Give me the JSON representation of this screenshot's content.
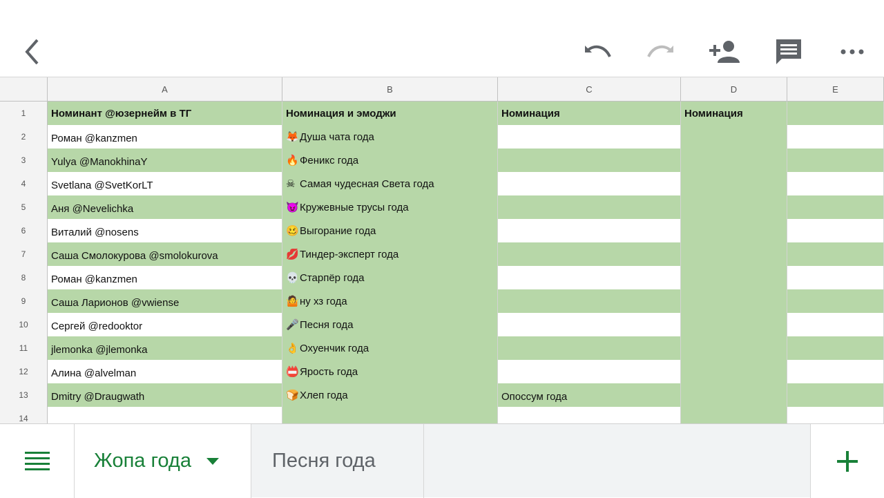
{
  "toolbar": {
    "back_icon": "chevron-left-icon",
    "undo_icon": "undo-icon",
    "redo_icon": "redo-icon",
    "share_icon": "add-person-icon",
    "comment_icon": "comment-icon",
    "more_icon": "more-horizontal-icon"
  },
  "columns": [
    "A",
    "B",
    "C",
    "D",
    "E"
  ],
  "rows": [
    {
      "num": "1",
      "a": "Номинант @юзернейм в ТГ",
      "b_emoji": "",
      "b": "Номинация и эмоджи",
      "c": "Номинация",
      "d": "Номинация",
      "e": ""
    },
    {
      "num": "2",
      "a": "Роман @kanzmen",
      "b_emoji": "🦊",
      "b": "Душа чата года",
      "c": "",
      "d": "",
      "e": ""
    },
    {
      "num": "3",
      "a": "Yulya @ManokhinaY",
      "b_emoji": "🔥",
      "b": "Феникс года",
      "c": "",
      "d": "",
      "e": ""
    },
    {
      "num": "4",
      "a": "Svetlana @SvetKorLT",
      "b_emoji": "☠",
      "b": "Самая чудесная Света года",
      "c": "",
      "d": "",
      "e": ""
    },
    {
      "num": "5",
      "a": "Аня @Nevelichka",
      "b_emoji": "😈",
      "b": "Кружевные трусы года",
      "c": "",
      "d": "",
      "e": ""
    },
    {
      "num": "6",
      "a": "Виталий @nosens",
      "b_emoji": "🥴",
      "b": "Выгорание года",
      "c": "",
      "d": "",
      "e": ""
    },
    {
      "num": "7",
      "a": "Саша Смолокурова @smolokurova",
      "b_emoji": "💋",
      "b": "Тиндер-эксперт года",
      "c": "",
      "d": "",
      "e": ""
    },
    {
      "num": "8",
      "a": "Роман @kanzmen",
      "b_emoji": "💀",
      "b": "Старпёр года",
      "c": "",
      "d": "",
      "e": ""
    },
    {
      "num": "9",
      "a": "Саша Ларионов @vwiense",
      "b_emoji": "🤷",
      "b": "ну хз года",
      "c": "",
      "d": "",
      "e": ""
    },
    {
      "num": "10",
      "a": "Сергей @redooktor",
      "b_emoji": "🎤",
      "b": "Песня года",
      "c": "",
      "d": "",
      "e": ""
    },
    {
      "num": "11",
      "a": "jlemonka @jlemonka",
      "b_emoji": "👌",
      "b": "Охуенчик года",
      "c": "",
      "d": "",
      "e": ""
    },
    {
      "num": "12",
      "a": "Алина @alvelman",
      "b_emoji": "📛",
      "b": "Ярость года",
      "c": "",
      "d": "",
      "e": ""
    },
    {
      "num": "13",
      "a": "Dmitry @Draugwath",
      "b_emoji": "🍞",
      "b": "Хлеп года",
      "c": "Опоссум года",
      "d": "",
      "e": ""
    },
    {
      "num": "14",
      "a": "",
      "b_emoji": "",
      "b": "",
      "c": "",
      "d": "",
      "e": ""
    }
  ],
  "tabs": {
    "menu_icon": "menu-lines-icon",
    "active": "Жопа года",
    "inactive": "Песня года",
    "add_icon": "plus-icon"
  },
  "colors": {
    "green_fill": "#b7d7a8",
    "accent": "#188038"
  }
}
